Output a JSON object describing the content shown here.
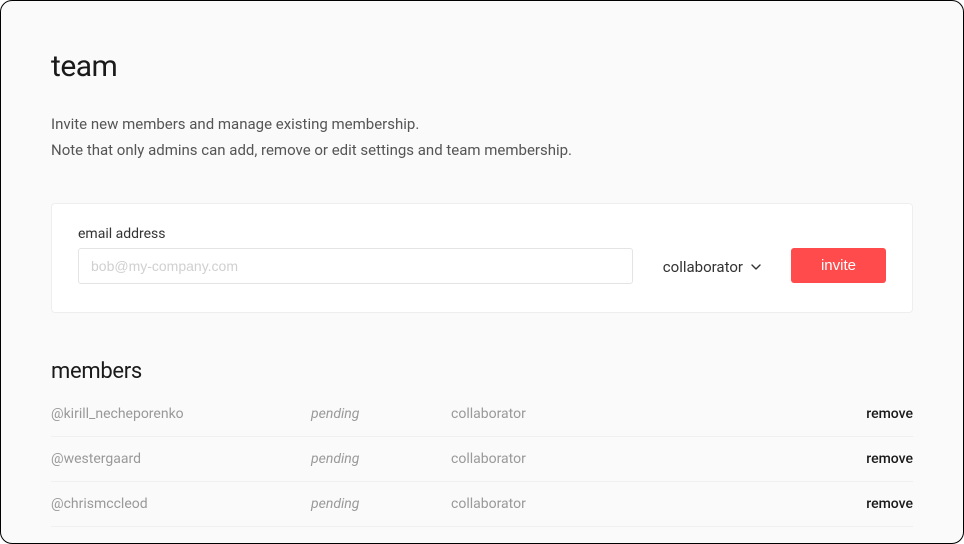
{
  "header": {
    "title": "team",
    "description_line1": "Invite new members and manage existing membership.",
    "description_line2": "Note that only admins can add, remove or edit settings and team membership."
  },
  "invite": {
    "email_label": "email address",
    "email_placeholder": "bob@my-company.com",
    "email_value": "",
    "role_selected": "collaborator",
    "button_label": "invite"
  },
  "members": {
    "title": "members",
    "rows": [
      {
        "handle": "@kirill_necheporenko",
        "status": "pending",
        "role": "collaborator",
        "action": "remove"
      },
      {
        "handle": "@westergaard",
        "status": "pending",
        "role": "collaborator",
        "action": "remove"
      },
      {
        "handle": "@chrismccleod",
        "status": "pending",
        "role": "collaborator",
        "action": "remove"
      }
    ]
  }
}
